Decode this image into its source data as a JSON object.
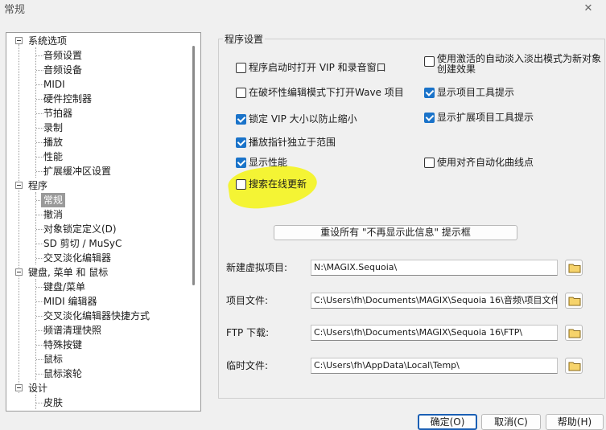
{
  "window": {
    "title": "常规",
    "close_glyph": "✕"
  },
  "tree": [
    {
      "label": "系统选项",
      "level": 0,
      "expander": true
    },
    {
      "label": "音频设置",
      "level": 1
    },
    {
      "label": "音频设备",
      "level": 1
    },
    {
      "label": "MIDI",
      "level": 1
    },
    {
      "label": "硬件控制器",
      "level": 1
    },
    {
      "label": "节拍器",
      "level": 1
    },
    {
      "label": "录制",
      "level": 1
    },
    {
      "label": "播放",
      "level": 1
    },
    {
      "label": "性能",
      "level": 1
    },
    {
      "label": "扩展缓冲区设置",
      "level": 1
    },
    {
      "label": "程序",
      "level": 0,
      "expander": true
    },
    {
      "label": "常规",
      "level": 1,
      "selected": true
    },
    {
      "label": "撤消",
      "level": 1
    },
    {
      "label": "对象锁定定义(D)",
      "level": 1
    },
    {
      "label": "SD 剪切 / MuSyC",
      "level": 1
    },
    {
      "label": "交叉淡化编辑器",
      "level": 1
    },
    {
      "label": "键盘, 菜单 和 鼠标",
      "level": 0,
      "expander": true
    },
    {
      "label": "键盘/菜单",
      "level": 1
    },
    {
      "label": "MIDI 编辑器",
      "level": 1
    },
    {
      "label": "交叉淡化编辑器快捷方式",
      "level": 1
    },
    {
      "label": "频谱清理快照",
      "level": 1
    },
    {
      "label": "特殊按键",
      "level": 1
    },
    {
      "label": "鼠标",
      "level": 1
    },
    {
      "label": "鼠标滚轮",
      "level": 1
    },
    {
      "label": "设计",
      "level": 0,
      "expander": true
    },
    {
      "label": "皮肤",
      "level": 1
    }
  ],
  "group": {
    "label": "程序设置"
  },
  "options": [
    {
      "label": "程序启动时打开 VIP 和录音窗口",
      "checked": false
    },
    {
      "label": "使用激活的自动淡入淡出模式为新对象创建效果",
      "checked": false
    },
    {
      "label": "在破坏性编辑模式下打开Wave 项目",
      "checked": false
    },
    {
      "label": "显示项目工具提示",
      "checked": true
    },
    {
      "label": "锁定 VIP 大小以防止缩小",
      "checked": true
    },
    {
      "label": "显示扩展项目工具提示",
      "checked": true
    },
    {
      "label": "播放指针独立于范围",
      "checked": true
    },
    {
      "label": "显示性能",
      "checked": true
    },
    {
      "label": "使用对齐自动化曲线点",
      "checked": false
    },
    {
      "label": "搜索在线更新",
      "checked": false
    }
  ],
  "reset_button": "重设所有 \"不再显示此信息\" 提示框",
  "fields": [
    {
      "label": "新建虚拟项目:",
      "value": "N:\\MAGIX.Sequoia\\"
    },
    {
      "label": "项目文件:",
      "value": "C:\\Users\\fh\\Documents\\MAGIX\\Sequoia 16\\音频\\项目文件\\"
    },
    {
      "label": "FTP 下载:",
      "value": "C:\\Users\\fh\\Documents\\MAGIX\\Sequoia 16\\FTP\\"
    },
    {
      "label": "临时文件:",
      "value": "C:\\Users\\fh\\AppData\\Local\\Temp\\"
    }
  ],
  "buttons": {
    "ok": "确定(O)",
    "cancel": "取消(C)",
    "help": "帮助(H)"
  },
  "colors": {
    "accent": "#1a73c9",
    "highlight": "#f5f513",
    "selection": "#9a9a9a"
  }
}
